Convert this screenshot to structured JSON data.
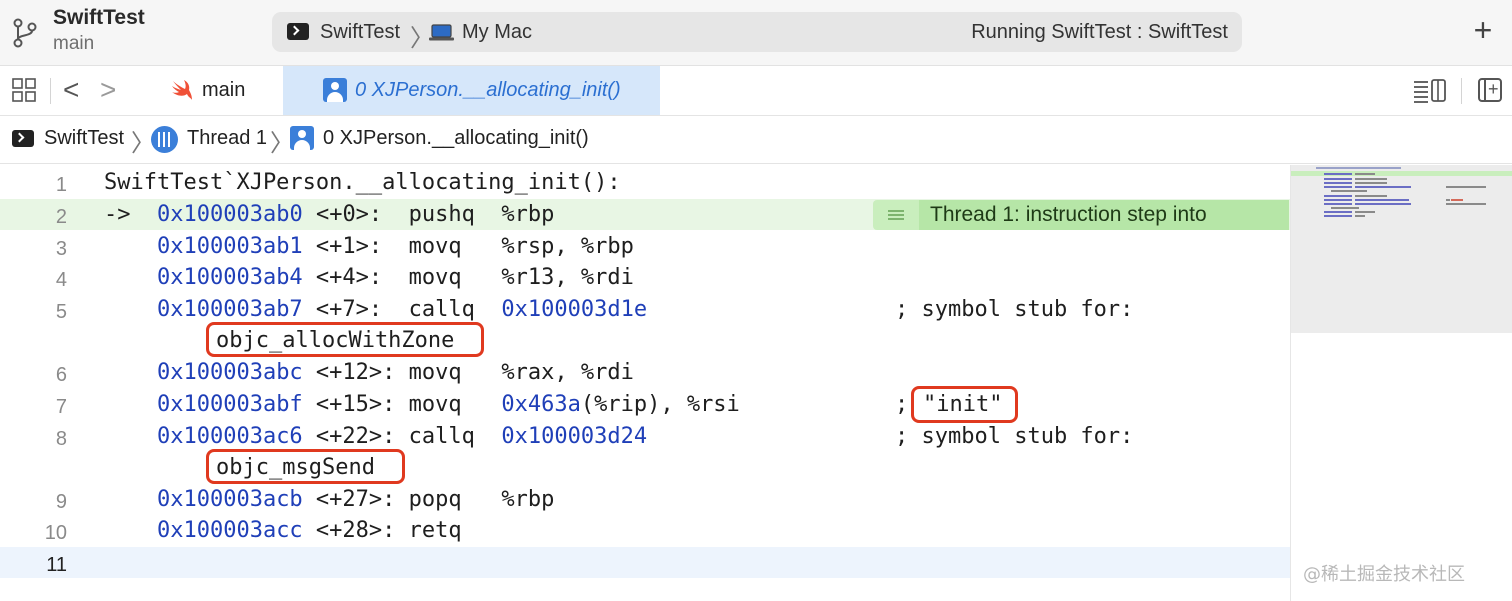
{
  "titlebar": {
    "project": "SwiftTest",
    "branch": "main",
    "scheme": "SwiftTest",
    "device": "My Mac",
    "status": "Running SwiftTest : SwiftTest",
    "icons": [
      "branch-icon",
      "terminal-icon",
      "laptop-icon",
      "plus-icon"
    ]
  },
  "tabs": [
    {
      "label": "main",
      "icon": "swift-icon",
      "active": false
    },
    {
      "label": "0 XJPerson.__allocating_init()",
      "icon": "person-frame-icon",
      "active": true
    }
  ],
  "jumpbar": {
    "items": [
      "SwiftTest",
      "Thread 1",
      "0 XJPerson.__allocating_init()"
    ]
  },
  "editor": {
    "stop_reason": "Thread 1: instruction step into",
    "lines": [
      {
        "num": "1",
        "arrow": "",
        "addr": "",
        "text": "SwiftTest`XJPerson.__allocating_init():",
        "comment": ""
      },
      {
        "num": "2",
        "arrow": "->",
        "addr": "0x100003ab0",
        "text": " <+0>:  pushq  %rbp",
        "comment": ""
      },
      {
        "num": "3",
        "arrow": "",
        "addr": "0x100003ab1",
        "text": " <+1>:  movq   %rsp, %rbp",
        "comment": ""
      },
      {
        "num": "4",
        "arrow": "",
        "addr": "0x100003ab4",
        "text": " <+4>:  movq   %r13, %rdi",
        "comment": ""
      },
      {
        "num": "5",
        "arrow": "",
        "addr": "0x100003ab7",
        "text": " <+7>:  callq  ",
        "target": "0x100003d1e",
        "comment": "; symbol stub for:",
        "continuation": "objc_allocWithZone"
      },
      {
        "num": "6",
        "arrow": "",
        "addr": "0x100003abc",
        "text": " <+12>: movq   %rax, %rdi",
        "comment": ""
      },
      {
        "num": "7",
        "arrow": "",
        "addr": "0x100003abf",
        "text": " <+15>: movq   ",
        "target": "0x463a",
        "text2": "(%rip), %rsi",
        "comment": ";",
        "string": "\"init\""
      },
      {
        "num": "8",
        "arrow": "",
        "addr": "0x100003ac6",
        "text": " <+22>: callq  ",
        "target": "0x100003d24",
        "comment": "; symbol stub for:",
        "continuation": "objc_msgSend"
      },
      {
        "num": "9",
        "arrow": "",
        "addr": "0x100003acb",
        "text": " <+27>: popq   %rbp",
        "comment": ""
      },
      {
        "num": "10",
        "arrow": "",
        "addr": "0x100003acc",
        "text": " <+28>: retq",
        "comment": ""
      },
      {
        "num": "11",
        "arrow": "",
        "addr": "",
        "text": "",
        "comment": ""
      }
    ]
  },
  "watermark": "@稀土掘金技术社区",
  "colors": {
    "address": "#1f3fb8",
    "string": "#c4291c",
    "highlight_line": "#e8f6e4",
    "stop_badge": "#b6e6a7",
    "annotation_box": "#e0391f",
    "active_tab": "#d6e7fa"
  }
}
